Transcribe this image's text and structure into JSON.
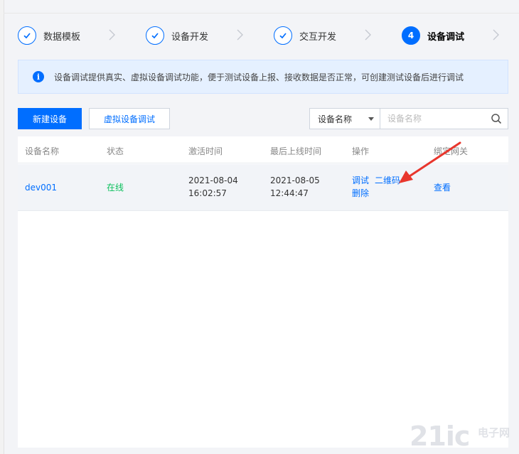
{
  "steps": [
    {
      "label": "数据模板",
      "state": "done"
    },
    {
      "label": "设备开发",
      "state": "done"
    },
    {
      "label": "交互开发",
      "state": "done"
    },
    {
      "label": "设备调试",
      "state": "active",
      "number": "4"
    }
  ],
  "banner": {
    "icon": "i",
    "text": "设备调试提供真实、虚拟设备调试功能，便于测试设备上报、接收数据是否正常，可创建测试设备后进行调试"
  },
  "toolbar": {
    "new_device_label": "新建设备",
    "virtual_debug_label": "虚拟设备调试",
    "filter_selected": "设备名称",
    "search_placeholder": "设备名称"
  },
  "table": {
    "headers": [
      "设备名称",
      "状态",
      "激活时间",
      "最后上线时间",
      "操作",
      "绑定网关"
    ],
    "rows": [
      {
        "name": "dev001",
        "status": "在线",
        "activated_date": "2021-08-04",
        "activated_time": "16:02:57",
        "last_online_date": "2021-08-05",
        "last_online_time": "12:44:47",
        "actions": {
          "debug": "调试",
          "qrcode": "二维码",
          "delete": "删除"
        },
        "gateway": "查看"
      }
    ]
  },
  "colors": {
    "accent": "#006eff",
    "online": "#0abf5b",
    "annotation": "#e8362d"
  },
  "watermark": {
    "text": "21ic",
    "cn": "电子网"
  }
}
